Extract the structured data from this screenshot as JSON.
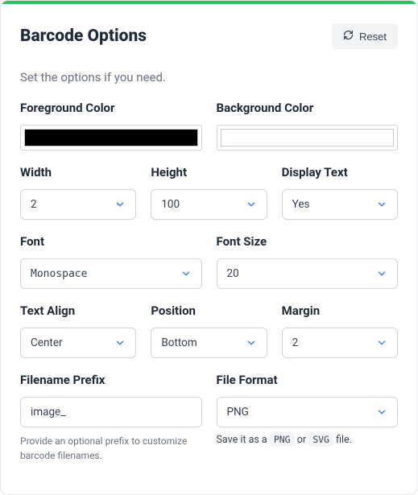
{
  "header": {
    "title": "Barcode Options",
    "reset_label": "Reset"
  },
  "subtitle": "Set the options if you need.",
  "colors": {
    "fg_label": "Foreground Color",
    "bg_label": "Background Color",
    "fg_value": "#000000",
    "bg_value": "#ffffff"
  },
  "dims": {
    "width_label": "Width",
    "width_value": "2",
    "height_label": "Height",
    "height_value": "100",
    "display_text_label": "Display Text",
    "display_text_value": "Yes"
  },
  "font_row": {
    "font_label": "Font",
    "font_value": "Monospace",
    "font_size_label": "Font Size",
    "font_size_value": "20"
  },
  "align_row": {
    "text_align_label": "Text Align",
    "text_align_value": "Center",
    "position_label": "Position",
    "position_value": "Bottom",
    "margin_label": "Margin",
    "margin_value": "2"
  },
  "file_row": {
    "prefix_label": "Filename Prefix",
    "prefix_value": "image_",
    "prefix_help": "Provide an optional prefix to customize barcode filenames.",
    "format_label": "File Format",
    "format_value": "PNG",
    "format_note_prefix": "Save it as a",
    "format_chip_png": "PNG",
    "format_note_or": "or",
    "format_chip_svg": "SVG",
    "format_note_suffix": "file."
  }
}
